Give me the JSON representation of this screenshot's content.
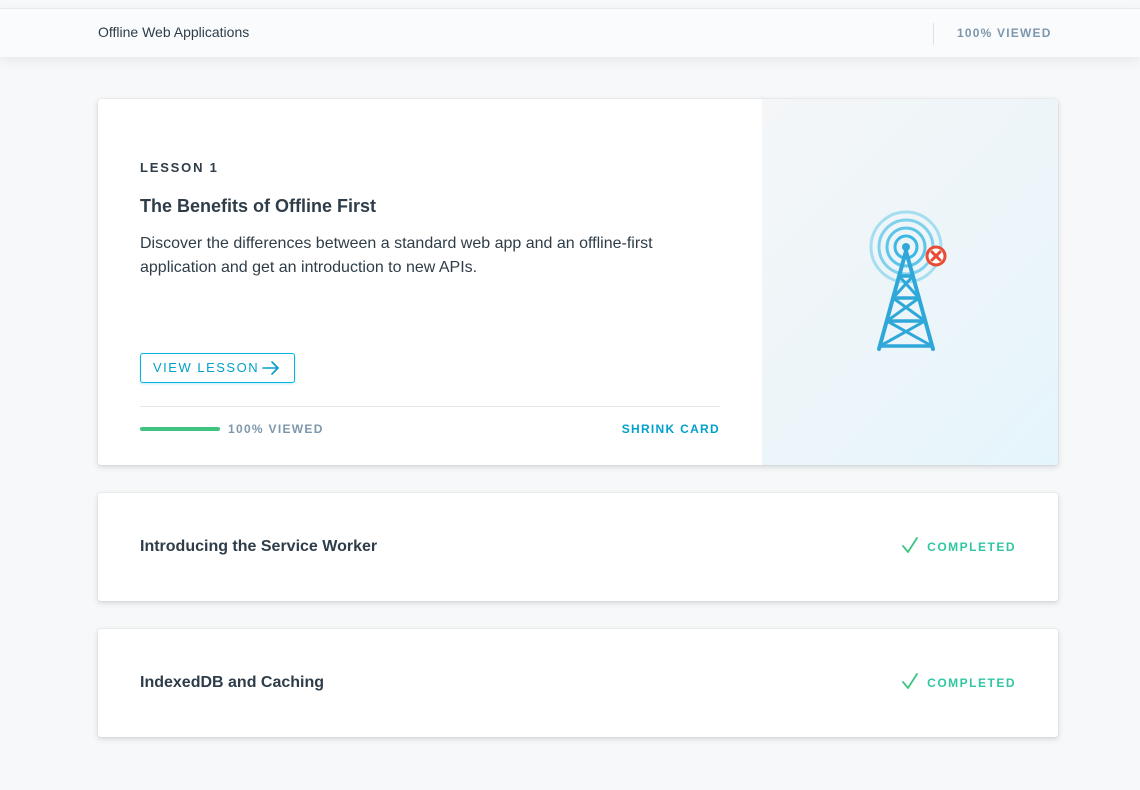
{
  "header": {
    "title": "Offline Web Applications",
    "status": "100% VIEWED"
  },
  "expanded_lesson": {
    "label": "LESSON 1",
    "title": "The Benefits of Offline First",
    "description": "Discover the differences between a standard web app and an offline-first application and get an introduction to new APIs.",
    "button_label": "VIEW LESSON",
    "progress_percent": 100,
    "progress_label": "100% VIEWED",
    "shrink_label": "SHRINK CARD",
    "image_icon": "cell-tower-offline-icon"
  },
  "lessons": [
    {
      "title": "Introducing the Service Worker",
      "status": "COMPLETED",
      "status_icon": "check-icon"
    },
    {
      "title": "IndexedDB and Caching",
      "status": "COMPLETED",
      "status_icon": "check-icon"
    }
  ],
  "colors": {
    "accent": "#02b3e4",
    "progress": "#3fc380",
    "completed": "#31c6a1",
    "error": "#e94b35",
    "text": "#2e3d49",
    "muted": "#7d97ad"
  }
}
